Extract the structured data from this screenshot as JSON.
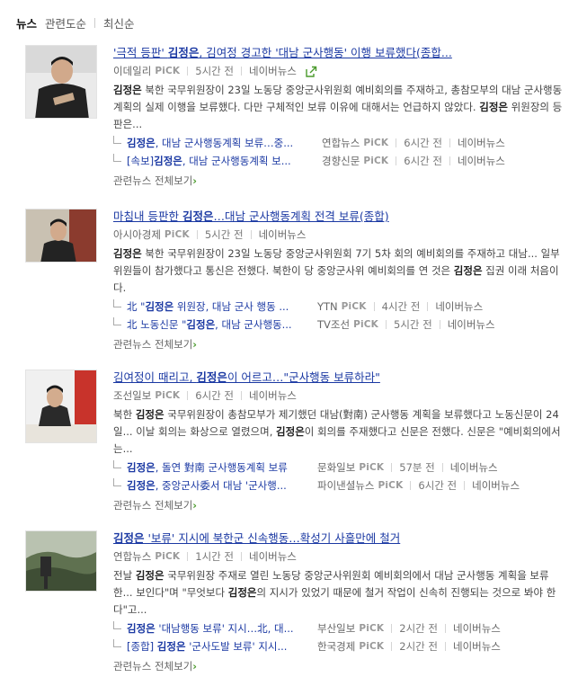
{
  "tabs": [
    {
      "label": "뉴스",
      "active": true
    },
    {
      "label": "관련도순",
      "active": false
    },
    {
      "label": "최신순",
      "active": false
    }
  ],
  "articles": [
    {
      "headline": {
        "pre": "'극적 등판' ",
        "bold": "김정은",
        "post": ", 김여정 경고한 '대남 군사행동' 이행 보류했다(종합..."
      },
      "source": "이데일리",
      "pick": "PiCK",
      "time": "5시간 전",
      "naver": "네이버뉴스",
      "summary": [
        {
          "b": "김정은"
        },
        {
          "t": " 북한 국무위원장이 23일 노동당 중앙군사위원회 예비회의를 주재하고, 총참모부의 대남 군사행동 계획의 실제 이행을 보류했다. 다만 구체적인 보류 이유에 대해서는 언급하지 않았다. "
        },
        {
          "b": "김정은"
        },
        {
          "t": " 위원장의 등판은..."
        }
      ],
      "related": [
        {
          "pre": "",
          "bold": "김정은",
          "post": ", 대남 군사행동계획 보류…중...",
          "source": "연합뉴스",
          "pick": "PiCK",
          "time": "6시간 전",
          "naver": "네이버뉴스"
        },
        {
          "pre": "[속보]",
          "bold": "김정은",
          "post": ", 대남 군사행동계획 보...",
          "source": "경향신문",
          "pick": "PiCK",
          "time": "6시간 전",
          "naver": "네이버뉴스"
        }
      ],
      "more": "관련뉴스 전체보기",
      "more_arrow": "›"
    },
    {
      "headline": {
        "pre": "마침내 등판한 ",
        "bold": "김정은",
        "post": "…대남 군사행동계획 전격 보류(종합)"
      },
      "source": "아시아경제",
      "pick": "PiCK",
      "time": "5시간 전",
      "naver": "네이버뉴스",
      "summary": [
        {
          "b": "김정은"
        },
        {
          "t": " 북한 국무위원장이 23일 노동당 중앙군사위원회 7기 5차 회의 예비회의를 주재하고 대남... 일부 위원들이 참가했다고 통신은 전했다. 북한이 당 중앙군사위 예비회의를 연 것은 "
        },
        {
          "b": "김정은"
        },
        {
          "t": " 집권 이래 처음이다."
        }
      ],
      "related": [
        {
          "pre": "北 \"",
          "bold": "김정은",
          "post": " 위원장, 대남 군사 행동 ...",
          "source": "YTN",
          "pick": "PiCK",
          "time": "4시간 전",
          "naver": "네이버뉴스"
        },
        {
          "pre": "北 노동신문 \"",
          "bold": "김정은",
          "post": ", 대남 군사행동...",
          "source": "TV조선",
          "pick": "PiCK",
          "time": "5시간 전",
          "naver": "네이버뉴스"
        }
      ],
      "more": "관련뉴스 전체보기",
      "more_arrow": "›"
    },
    {
      "headline": {
        "pre": "김여정이 때리고, ",
        "bold": "김정은",
        "post": "이 어르고…\"군사행동 보류하라\""
      },
      "source": "조선일보",
      "pick": "PiCK",
      "time": "6시간 전",
      "naver": "네이버뉴스",
      "summary": [
        {
          "t": "북한 "
        },
        {
          "b": "김정은"
        },
        {
          "t": " 국무위원장이 총참모부가 제기했던 대남(對南) 군사행동 계획을 보류했다고 노동신문이 24일... 이날 회의는 화상으로 열렸으며, "
        },
        {
          "b": "김정은"
        },
        {
          "t": "이 회의를 주재했다고 신문은 전했다. 신문은 \"예비회의에서는..."
        }
      ],
      "related": [
        {
          "pre": "",
          "bold": "김정은",
          "post": ", 돌연 對南 군사행동계획 보류",
          "source": "문화일보",
          "pick": "PiCK",
          "time": "57분 전",
          "naver": "네이버뉴스"
        },
        {
          "pre": "",
          "bold": "김정은",
          "post": ", 중앙군사委서 대남 '군사행...",
          "source": "파이낸셜뉴스",
          "pick": "PiCK",
          "time": "6시간 전",
          "naver": "네이버뉴스"
        }
      ],
      "more": "관련뉴스 전체보기",
      "more_arrow": "›"
    },
    {
      "headline": {
        "pre": "",
        "bold": "김정은",
        "post": " '보류' 지시에 북한군 신속행동…확성기 사흘만에 철거"
      },
      "source": "연합뉴스",
      "pick": "PiCK",
      "time": "1시간 전",
      "naver": "네이버뉴스",
      "summary": [
        {
          "t": "전날 "
        },
        {
          "b": "김정은"
        },
        {
          "t": " 국무위원장 주재로 열린 노동당 중앙군사위원회 예비회의에서 대남 군사행동 계획을 보류한... 보인다\"며 \"무엇보다 "
        },
        {
          "b": "김정은"
        },
        {
          "t": "의 지시가 있었기 때문에 철거 작업이 신속히 진행되는 것으로 봐야 한다\"고..."
        }
      ],
      "related": [
        {
          "pre": "",
          "bold": "김정은",
          "post": " '대남행동 보류' 지시…北, 대...",
          "source": "부산일보",
          "pick": "PiCK",
          "time": "2시간 전",
          "naver": "네이버뉴스"
        },
        {
          "pre": "[종합] ",
          "bold": "김정은",
          "post": " '군사도발 보류' 지시...",
          "source": "한국경제",
          "pick": "PiCK",
          "time": "2시간 전",
          "naver": "네이버뉴스"
        }
      ],
      "more": "관련뉴스 전체보기",
      "more_arrow": "›"
    }
  ]
}
